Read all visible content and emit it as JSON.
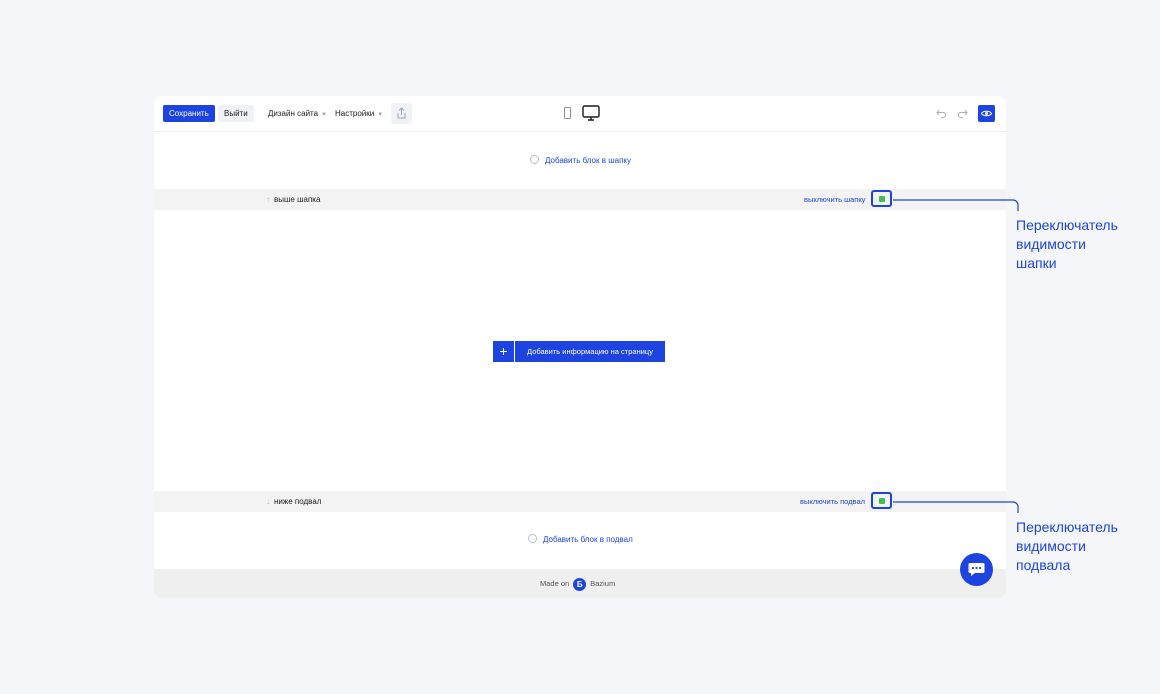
{
  "toolbar": {
    "save_label": "Сохранить",
    "exit_label": "Выйти",
    "design_label": "Дизайн сайта",
    "settings_label": "Настройки"
  },
  "canvas": {
    "add_header_label": "Добавить блок в шапку",
    "header_bar_label": "выше шапка",
    "header_toggle_label": "выключить шапку",
    "add_info_label": "Добавить информацию на страницу",
    "footer_bar_label": "ниже подвал",
    "footer_toggle_label": "выключить подвал",
    "add_footer_label": "Добавить блок в подвал"
  },
  "footer": {
    "made_on": "Made on",
    "brand": "Bazium",
    "logo_letter": "Б"
  },
  "annotations": {
    "header_toggle_lines": [
      "Переключатель",
      "видимости",
      "шапки"
    ],
    "footer_toggle_lines": [
      "Переключатель",
      "видимости",
      "подвала"
    ]
  },
  "colors": {
    "accent": "#1d44e0",
    "toggle_on": "#3fbf59"
  }
}
